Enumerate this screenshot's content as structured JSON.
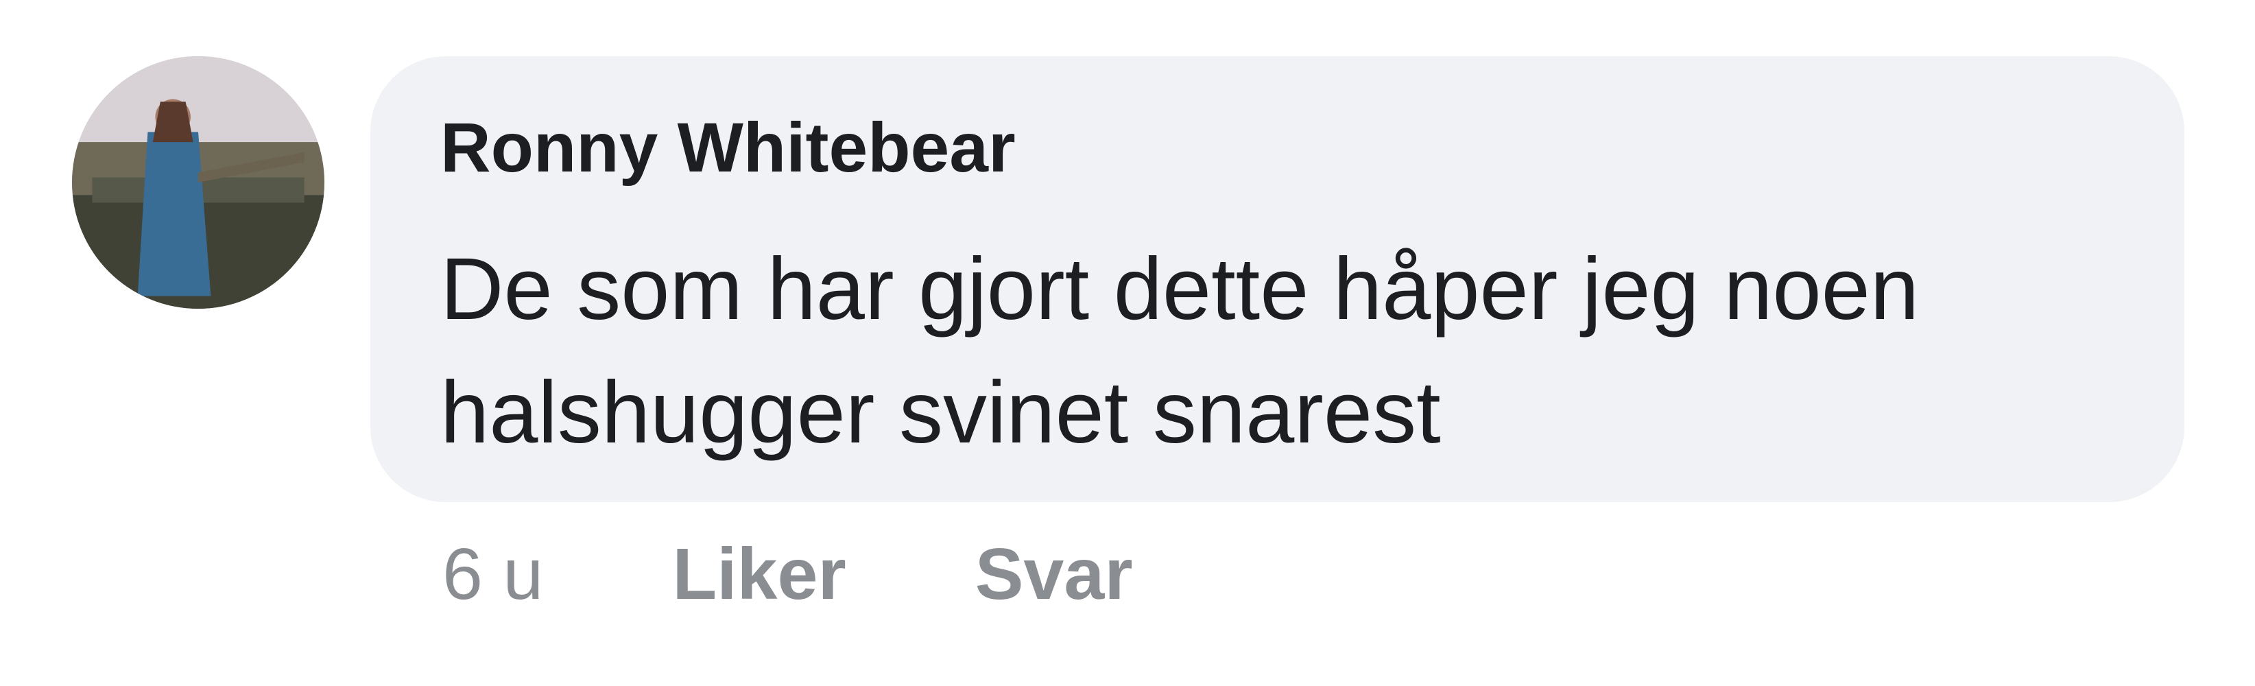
{
  "comment": {
    "author": "Ronny Whitebear",
    "text": "De som har gjort dette håper jeg noen halshugger svinet snarest",
    "time": "6 u",
    "like_label": "Liker",
    "reply_label": "Svar"
  },
  "colors": {
    "bubble_background": "#f0f2f5",
    "text": "#1c1e21",
    "meta": "#8a8d91"
  }
}
